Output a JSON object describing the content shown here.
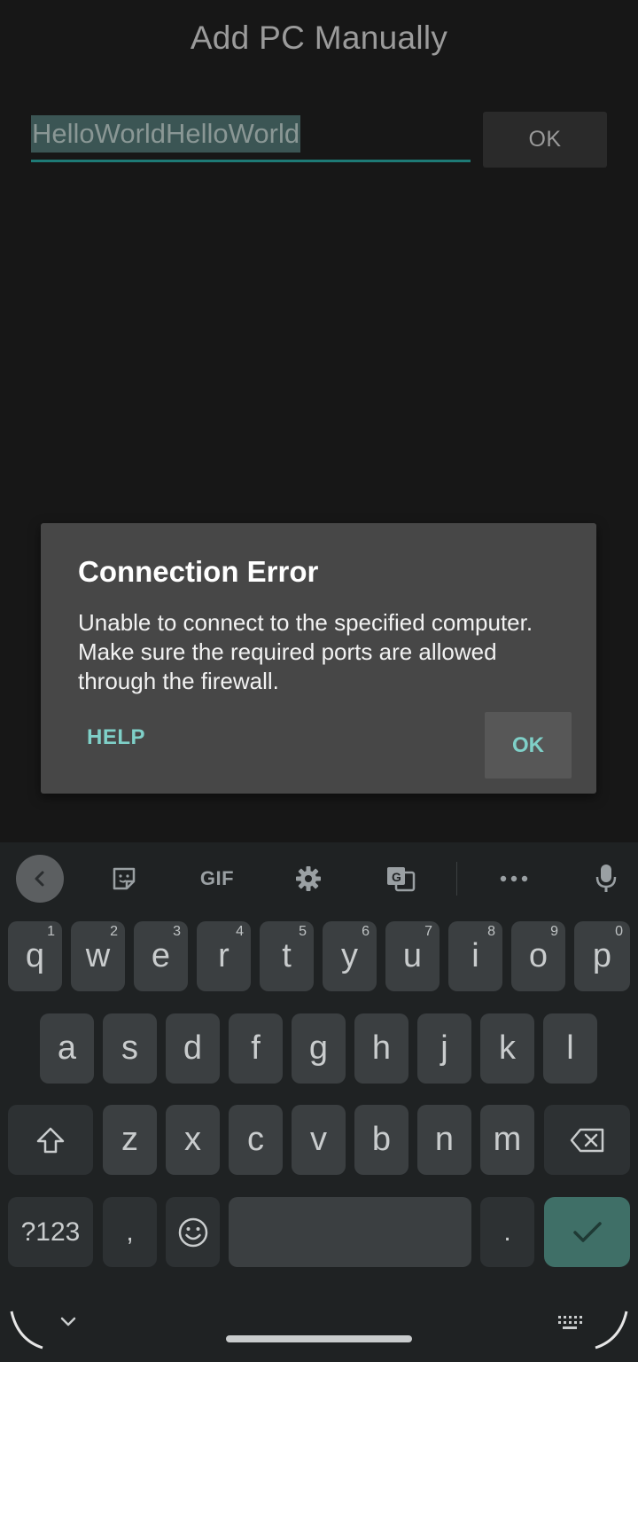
{
  "page": {
    "title": "Add PC Manually",
    "host_input_value": "HelloWorldHelloWorld",
    "ok_label": "OK"
  },
  "dialog": {
    "title": "Connection Error",
    "message": "Unable to connect to the specified computer. Make sure the required ports are allowed through the firewall.",
    "help_label": "HELP",
    "ok_label": "OK"
  },
  "keyboard": {
    "toolbar": {
      "gif_label": "GIF",
      "icons": [
        "back-icon",
        "sticker-icon",
        "gif-icon",
        "settings-icon",
        "translate-icon",
        "more-icon",
        "mic-icon"
      ]
    },
    "row1": [
      {
        "key": "q",
        "hint": "1"
      },
      {
        "key": "w",
        "hint": "2"
      },
      {
        "key": "e",
        "hint": "3"
      },
      {
        "key": "r",
        "hint": "4"
      },
      {
        "key": "t",
        "hint": "5"
      },
      {
        "key": "y",
        "hint": "6"
      },
      {
        "key": "u",
        "hint": "7"
      },
      {
        "key": "i",
        "hint": "8"
      },
      {
        "key": "o",
        "hint": "9"
      },
      {
        "key": "p",
        "hint": "0"
      }
    ],
    "row2": [
      "a",
      "s",
      "d",
      "f",
      "g",
      "h",
      "j",
      "k",
      "l"
    ],
    "row3": [
      "z",
      "x",
      "c",
      "v",
      "b",
      "n",
      "m"
    ],
    "symbols_label": "?123",
    "comma_label": ",",
    "period_label": "."
  },
  "colors": {
    "accent": "#7fd0c8",
    "background": "#171717",
    "dialog": "#474747",
    "enter_key": "#3f6f67"
  }
}
